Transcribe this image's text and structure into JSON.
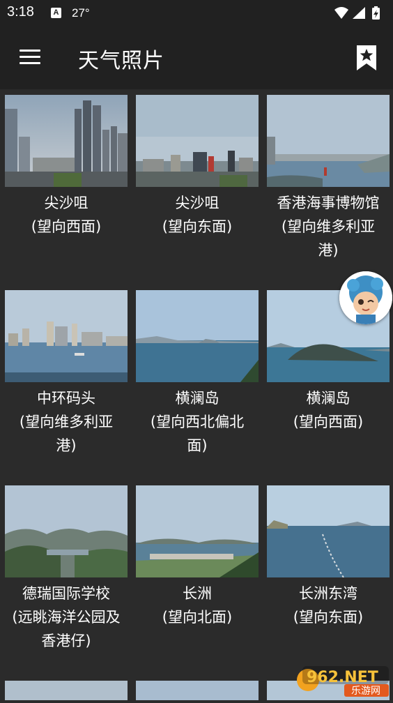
{
  "status": {
    "time": "3:18",
    "temperature": "27°",
    "a_icon": "A"
  },
  "appbar": {
    "title": "天气照片"
  },
  "icons": {
    "menu": "hamburger-icon",
    "bookmark": "bookmark-star-icon",
    "wifi": "wifi-icon",
    "signal": "signal-icon",
    "battery": "battery-charging-icon"
  },
  "photos": [
    {
      "line1": "尖沙咀",
      "line2": "(望向西面)",
      "line3": ""
    },
    {
      "line1": "尖沙咀",
      "line2": "(望向东面)",
      "line3": ""
    },
    {
      "line1": "香港海事博物馆",
      "line2": "(望向维多利亚",
      "line3": "港)"
    },
    {
      "line1": "中环码头",
      "line2": "(望向维多利亚",
      "line3": "港)"
    },
    {
      "line1": "横澜岛",
      "line2": "(望向西北偏北",
      "line3": "面)"
    },
    {
      "line1": "横澜岛",
      "line2": "(望向西面)",
      "line3": ""
    },
    {
      "line1": "德瑞国际学校",
      "line2": "(远眺海洋公园及",
      "line3": "香港仔)"
    },
    {
      "line1": "长洲",
      "line2": "(望向北面)",
      "line3": ""
    },
    {
      "line1": "长洲东湾",
      "line2": "(望向东面)",
      "line3": ""
    }
  ],
  "watermark": {
    "brand": "962.NET",
    "sub": "乐游网"
  }
}
